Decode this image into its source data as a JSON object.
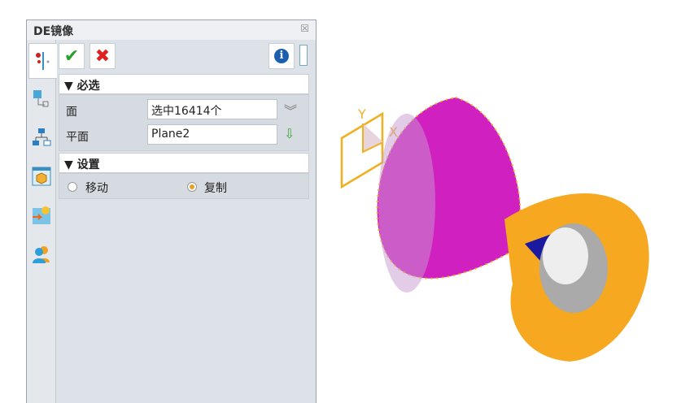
{
  "dialog": {
    "title": "DE镜像",
    "close": "☒"
  },
  "toolbar": {
    "ok": "✔",
    "cancel": "✖",
    "info": "i"
  },
  "required": {
    "header": "▼ 必选",
    "face_label": "面",
    "face_value": "选中16414个",
    "plane_label": "平面",
    "plane_value": "Plane2"
  },
  "settings": {
    "header": "▼ 设置",
    "move_label": "移动",
    "copy_label": "复制",
    "selected": "复制"
  },
  "viewport": {
    "axis_y": "Y",
    "axis_x": "X"
  }
}
